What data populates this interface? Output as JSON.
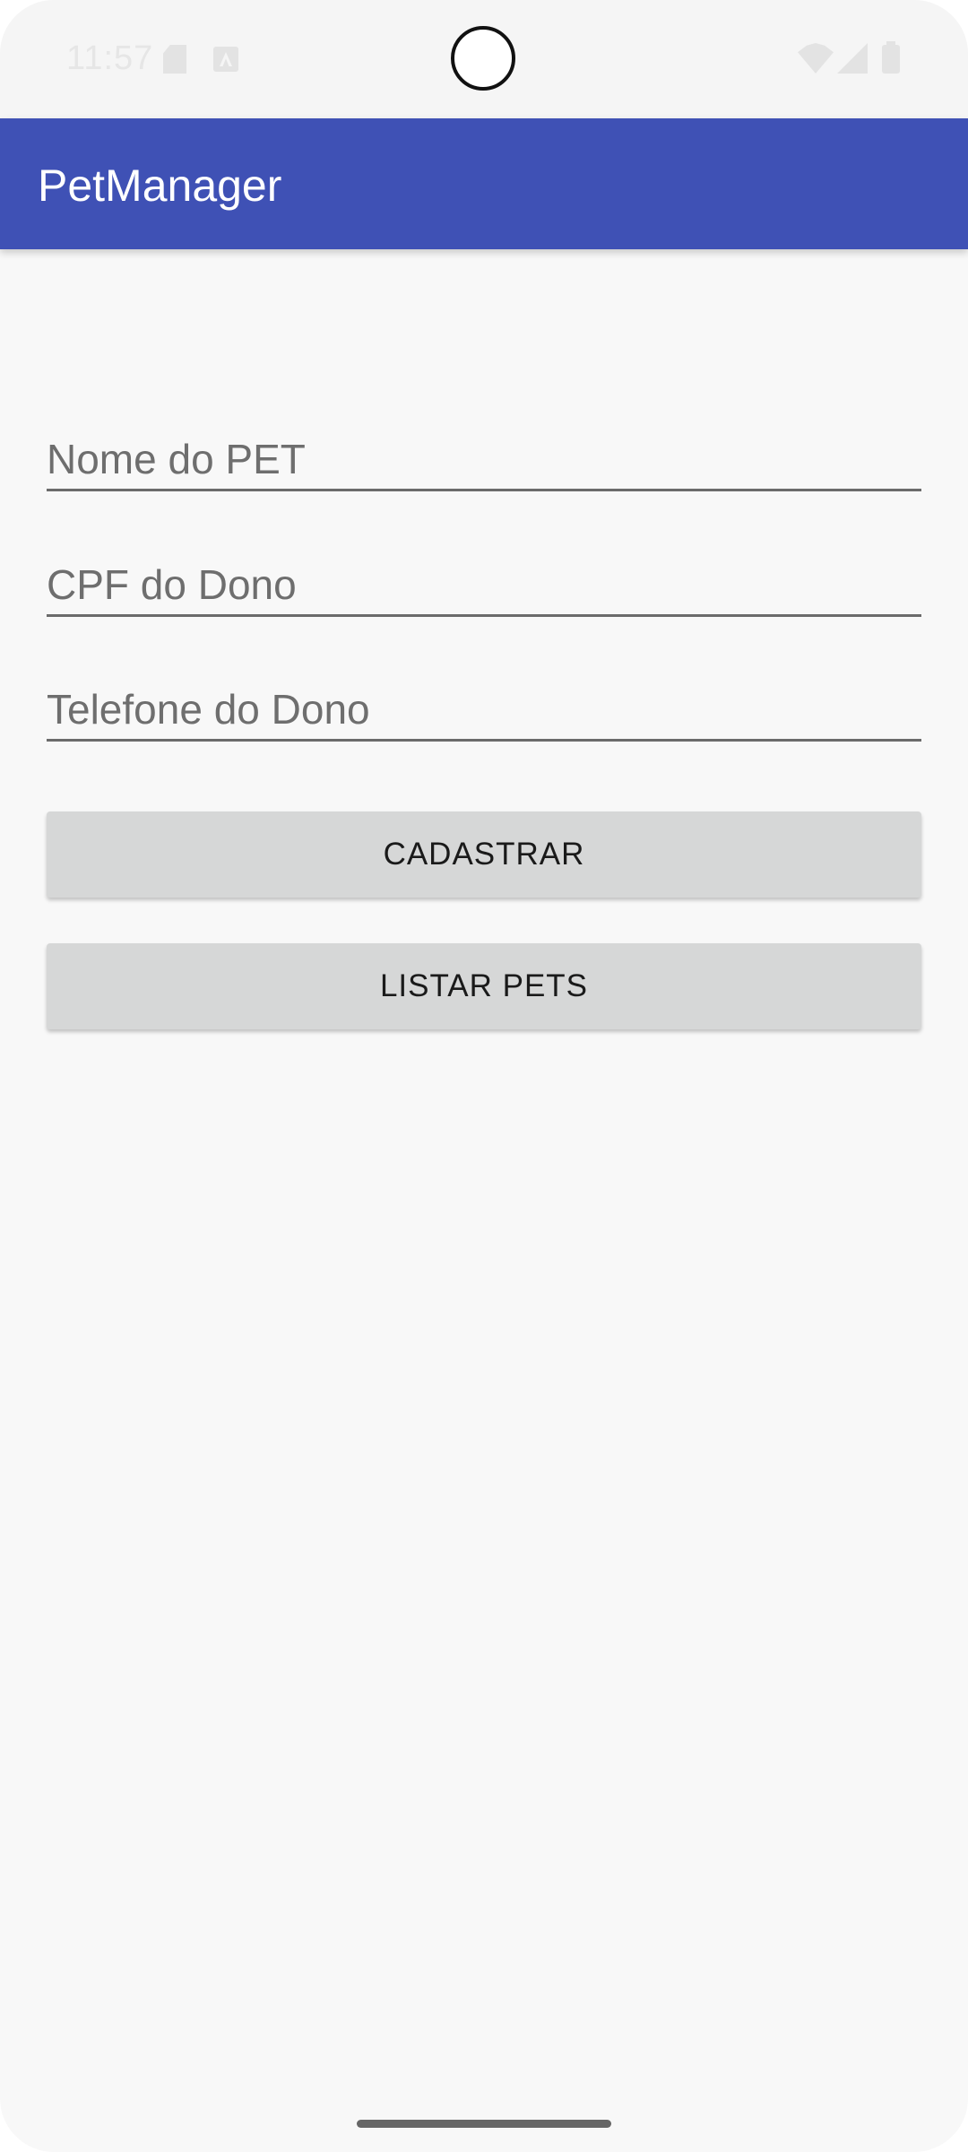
{
  "status_bar": {
    "time": "11:57",
    "icons": [
      "sd-card-icon",
      "app-notification-icon",
      "wifi-icon",
      "cell-signal-icon",
      "battery-icon"
    ]
  },
  "app_bar": {
    "title": "PetManager",
    "color": "#3f51b5"
  },
  "form": {
    "pet_name": {
      "value": "",
      "placeholder": "Nome do PET"
    },
    "owner_cpf": {
      "value": "",
      "placeholder": "CPF do Dono"
    },
    "owner_phone": {
      "value": "",
      "placeholder": "Telefone do Dono"
    }
  },
  "buttons": {
    "register_label": "CADASTRAR",
    "list_label": "LISTAR PETS"
  }
}
